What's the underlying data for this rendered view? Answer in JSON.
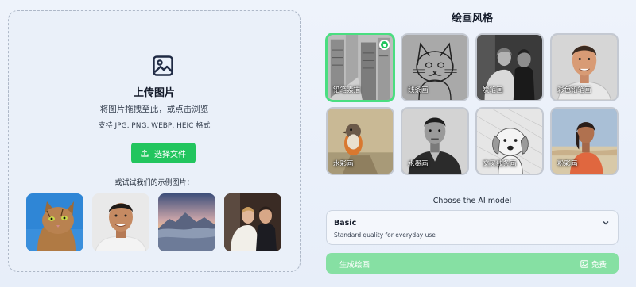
{
  "upload": {
    "title": "上传图片",
    "subtitle": "将图片拖拽至此，或点击浏览",
    "formats": "支持 JPG, PNG, WEBP, HEIC 格式",
    "choose_button": "选择文件",
    "samples_label": "或试试我们的示例图片：",
    "samples": [
      {
        "icon": "cat-photo"
      },
      {
        "icon": "man-portrait-photo"
      },
      {
        "icon": "mountain-landscape-photo"
      },
      {
        "icon": "wedding-couple-photo"
      }
    ]
  },
  "styles": {
    "title": "绘画风格",
    "selected_index": 0,
    "items": [
      {
        "label": "铅笔素描"
      },
      {
        "label": "线条画"
      },
      {
        "label": "炭笔画"
      },
      {
        "label": "彩色铅笔画"
      },
      {
        "label": "水彩画"
      },
      {
        "label": "水墨画"
      },
      {
        "label": "交叉线条画"
      },
      {
        "label": "粉彩画"
      }
    ]
  },
  "model": {
    "label": "Choose the AI model",
    "selected_name": "Basic",
    "selected_desc": "Standard quality for everyday use"
  },
  "generate": {
    "label": "生成绘画",
    "cost": "免费"
  },
  "colors": {
    "accent": "#22c55e",
    "generate_disabled": "#86e0a3",
    "selected_border": "#4ade80"
  }
}
